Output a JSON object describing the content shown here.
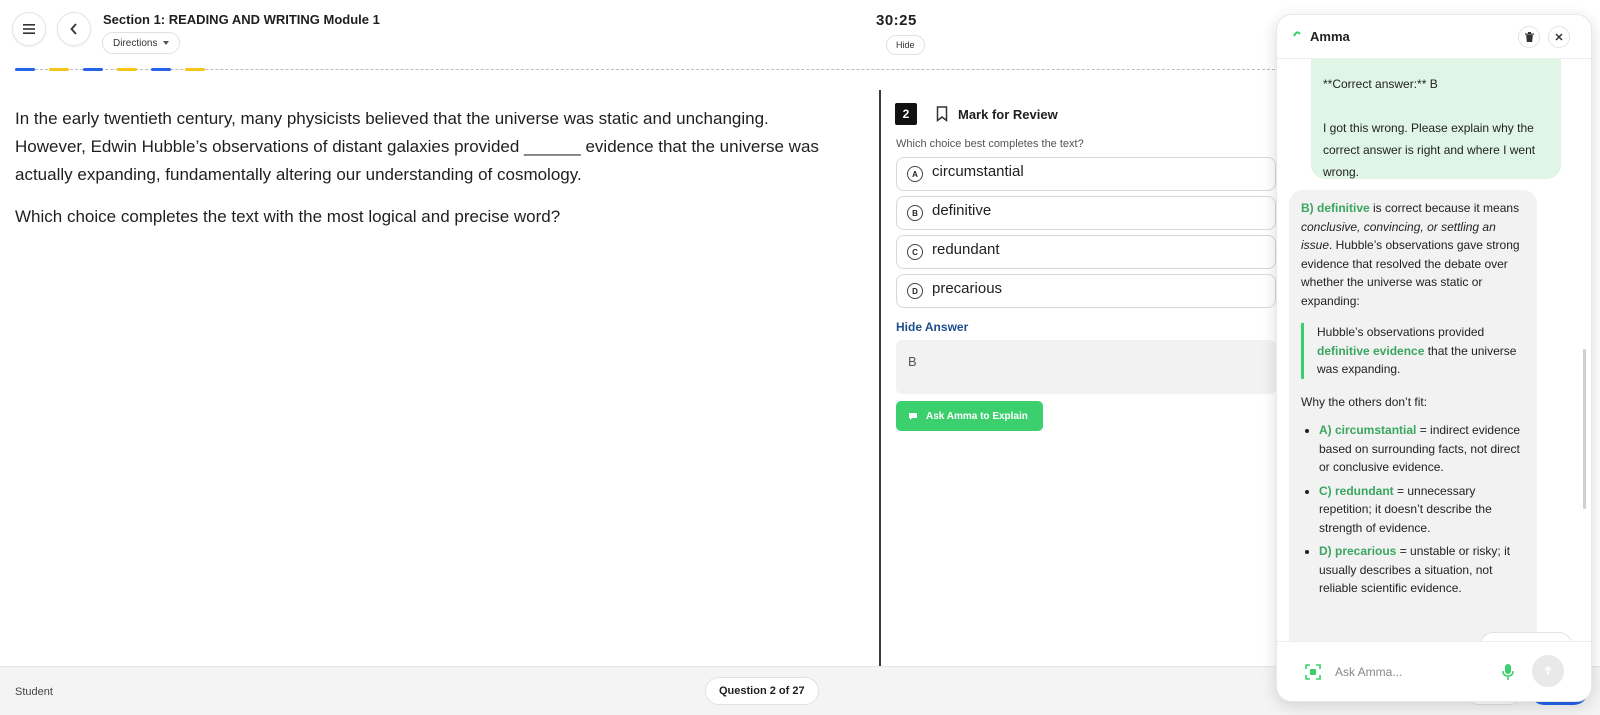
{
  "header": {
    "section_title": "Section 1: READING AND WRITING Module 1",
    "directions_label": "Directions",
    "timer": "30:25",
    "hide_label": "Hide"
  },
  "progress_segments": [
    {
      "color": "#2563eb"
    },
    {
      "color": "#f5c518"
    },
    {
      "color": "#2563eb"
    },
    {
      "color": "#f5c518"
    },
    {
      "color": "#2563eb"
    },
    {
      "color": "#f5c518"
    }
  ],
  "passage": {
    "text": "In the early twentieth century, many physicists believed that the universe was static and unchanging. However, Edwin Hubble’s observations of distant galaxies provided ______ evidence that the universe was actually expanding, fundamentally altering our understanding of cosmology.",
    "prompt": "Which choice completes the text with the most logical and precise word?"
  },
  "question": {
    "number": "2",
    "mark_for_review": "Mark for Review",
    "stem": "Which choice best completes the text?",
    "choices": [
      {
        "letter": "A",
        "text": "circumstantial"
      },
      {
        "letter": "B",
        "text": "definitive"
      },
      {
        "letter": "C",
        "text": "redundant"
      },
      {
        "letter": "D",
        "text": "precarious"
      }
    ],
    "hide_answer_label": "Hide Answer",
    "answer": "B",
    "ask_button_label": "Ask Amma to Explain"
  },
  "footer": {
    "user_label": "Student",
    "question_counter": "Question 2 of 27"
  },
  "chat": {
    "title": "Amma",
    "user_message": {
      "line1": "**Correct answer:** B",
      "line2": "I got this wrong. Please explain why the correct answer is right and where I went wrong."
    },
    "ai_message": {
      "intro_bold": "B) definitive",
      "intro_1": " is correct because it means ",
      "intro_italic": "conclusive, convincing, or settling an issue",
      "intro_2": ". Hubble’s observations gave strong evidence that resolved the debate over whether the universe was static or expanding:",
      "quote_1": "Hubble’s observations provided ",
      "quote_bold": "definitive evidence",
      "quote_2": " that the universe was expanding.",
      "why_heading": "Why the others don’t fit:",
      "items": [
        {
          "label": "A) circumstantial",
          "text": " = indirect evidence based on surrounding facts, not direct or conclusive evidence."
        },
        {
          "label": "C) redundant",
          "text": " = unnecessary repetition; it doesn’t describe the strength of evidence."
        },
        {
          "label": "D) precarious",
          "text": " = unstable or risky; it usually describes a situation, not reliable scientific evidence."
        }
      ]
    },
    "input_placeholder": "Ask Amma..."
  },
  "colors": {
    "accent_green": "#3ccf6e",
    "link_blue": "#1f4e8c",
    "primary_blue": "#2563eb"
  }
}
